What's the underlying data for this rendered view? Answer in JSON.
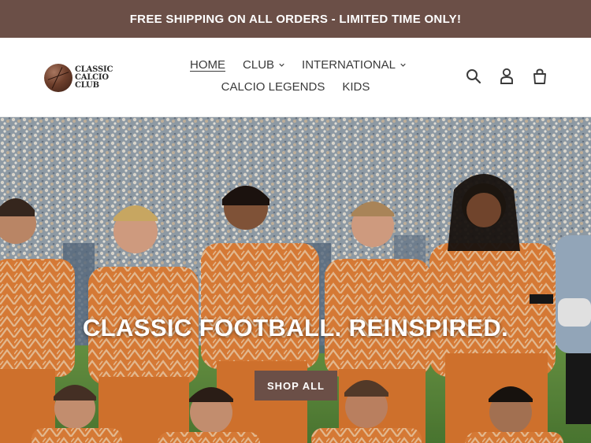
{
  "announcement": {
    "text": "FREE SHIPPING ON ALL ORDERS - LIMITED TIME ONLY!"
  },
  "logo": {
    "lines": [
      "CLASSIC",
      "CALCIO",
      "CLUB"
    ]
  },
  "nav": {
    "row1": [
      {
        "label": "HOME",
        "active": true,
        "dropdown": false
      },
      {
        "label": "CLUB",
        "active": false,
        "dropdown": true
      },
      {
        "label": "INTERNATIONAL",
        "active": false,
        "dropdown": true
      }
    ],
    "row2": [
      {
        "label": "CALCIO LEGENDS",
        "active": false,
        "dropdown": false
      },
      {
        "label": "KIDS",
        "active": false,
        "dropdown": false
      }
    ]
  },
  "header_icons": [
    "search-icon",
    "account-icon",
    "cart-icon"
  ],
  "hero": {
    "title": "CLASSIC FOOTBALL. REINSPIRED.",
    "button_label": "SHOP ALL"
  },
  "colors": {
    "brand": "#6b4f47",
    "kit_orange": "#e8843a",
    "pitch": "#5f8f3e"
  }
}
